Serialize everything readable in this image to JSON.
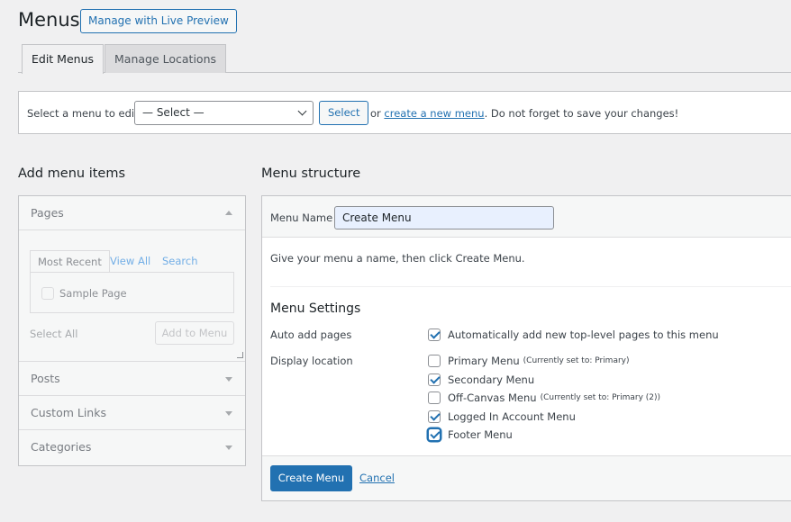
{
  "page": {
    "title": "Menus",
    "live_preview_label": "Manage with Live Preview"
  },
  "tabs": [
    {
      "label": "Edit Menus",
      "active": true
    },
    {
      "label": "Manage Locations",
      "active": false
    }
  ],
  "select_bar": {
    "label": "Select a menu to edit:",
    "dropdown_value": "— Select —",
    "select_button": "Select",
    "note_prefix": "or",
    "note_link": "create a new menu",
    "note_suffix": ". Do not forget to save your changes!"
  },
  "add_items": {
    "title": "Add menu items",
    "pages": {
      "label": "Pages",
      "tabs": [
        "Most Recent",
        "View All",
        "Search"
      ],
      "items": [
        "Sample Page"
      ],
      "select_all": "Select All",
      "add_button": "Add to Menu"
    },
    "sections": [
      "Posts",
      "Custom Links",
      "Categories"
    ]
  },
  "structure": {
    "title": "Menu structure",
    "name_label": "Menu Name",
    "name_value": "Create Menu",
    "hint": "Give your menu a name, then click Create Menu.",
    "settings_title": "Menu Settings",
    "auto_add_label": "Auto add pages",
    "auto_add_option": {
      "label": "Automatically add new top-level pages to this menu",
      "checked": true
    },
    "display_location_label": "Display location",
    "locations": [
      {
        "label": "Primary Menu",
        "note": "(Currently set to: Primary)",
        "checked": false
      },
      {
        "label": "Secondary Menu",
        "note": "",
        "checked": true
      },
      {
        "label": "Off-Canvas Menu",
        "note": "(Currently set to: Primary (2))",
        "checked": false
      },
      {
        "label": "Logged In Account Menu",
        "note": "",
        "checked": true
      },
      {
        "label": "Footer Menu",
        "note": "",
        "checked": true
      }
    ],
    "create_button": "Create Menu",
    "cancel_link": "Cancel"
  },
  "colors": {
    "accent": "#2271b1",
    "background": "#f0f0f1"
  }
}
